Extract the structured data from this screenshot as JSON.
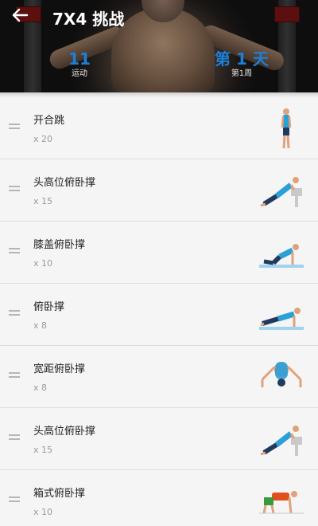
{
  "header": {
    "title": "7X4 挑战",
    "left_stat": {
      "value": "11",
      "label": "运动"
    },
    "right_stat": {
      "value": "第 1 天",
      "label": "第1周"
    }
  },
  "exercises": [
    {
      "name": "开合跳",
      "reps": "x 20",
      "illustration": "jumping-jacks"
    },
    {
      "name": "头高位俯卧撑",
      "reps": "x 15",
      "illustration": "incline-pushup"
    },
    {
      "name": "膝盖俯卧撑",
      "reps": "x 10",
      "illustration": "knee-pushup"
    },
    {
      "name": "俯卧撑",
      "reps": "x 8",
      "illustration": "pushup"
    },
    {
      "name": "宽距俯卧撑",
      "reps": "x 8",
      "illustration": "wide-pushup"
    },
    {
      "name": "头高位俯卧撑",
      "reps": "x 15",
      "illustration": "incline-pushup"
    },
    {
      "name": "箱式俯卧撑",
      "reps": "x 10",
      "illustration": "box-pushup"
    }
  ],
  "colors": {
    "accent": "#1e7fd8",
    "background": "#f2f2f2"
  }
}
